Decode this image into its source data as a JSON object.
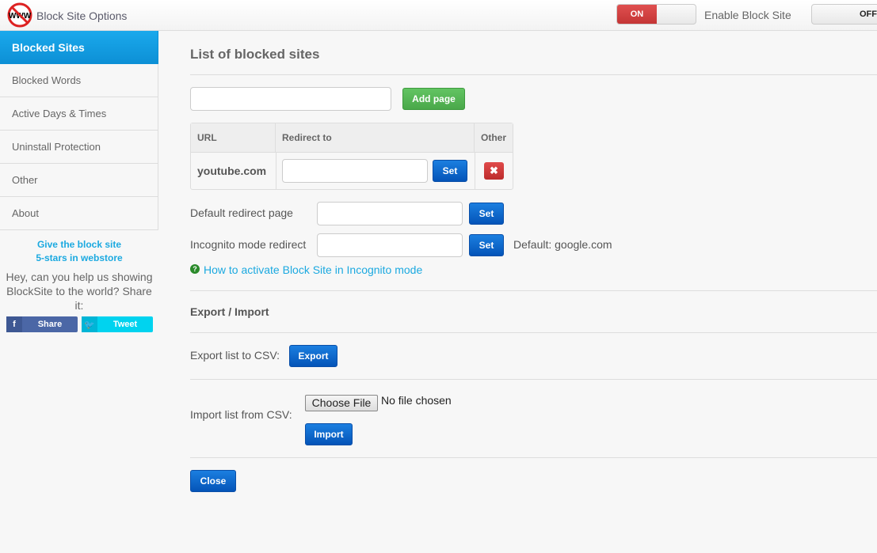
{
  "header": {
    "title": "Block Site Options",
    "logo_text": "WWW",
    "toggle_on_label": "ON",
    "enable_label": "Enable Block Site",
    "toggle_off_label": "OFF"
  },
  "sidebar": {
    "items": [
      {
        "label": "Blocked Sites"
      },
      {
        "label": "Blocked Words"
      },
      {
        "label": "Active Days & Times"
      },
      {
        "label": "Uninstall Protection"
      },
      {
        "label": "Other"
      },
      {
        "label": "About"
      }
    ],
    "rate_line1": "Give the block site",
    "rate_line2": "5-stars in webstore",
    "share_text": "Hey, can you help us showing BlockSite to the world? Share it:",
    "share_label": "Share",
    "tweet_label": "Tweet"
  },
  "main": {
    "title": "List of blocked sites",
    "add_input_value": "",
    "add_button": "Add page",
    "table": {
      "headers": [
        "URL",
        "Redirect to",
        "Other"
      ],
      "rows": [
        {
          "url": "youtube.com",
          "redirect": "",
          "set_label": "Set"
        }
      ]
    },
    "default_redirect_label": "Default redirect page",
    "default_redirect_value": "",
    "set_label": "Set",
    "incognito_label": "Incognito mode redirect",
    "incognito_value": "",
    "incognito_default": "Default: google.com",
    "incognito_help": "How to activate Block Site in Incognito mode",
    "export_import_title": "Export / Import",
    "export_label": "Export list to CSV:",
    "export_button": "Export",
    "import_label": "Import list from CSV:",
    "choose_file": "Choose File",
    "no_file": "No file chosen",
    "import_button": "Import",
    "close_button": "Close"
  },
  "colors": {
    "accent": "#1aa9ec",
    "danger": "#c43535",
    "success": "#4aa84a",
    "primary": "#0454b8"
  }
}
